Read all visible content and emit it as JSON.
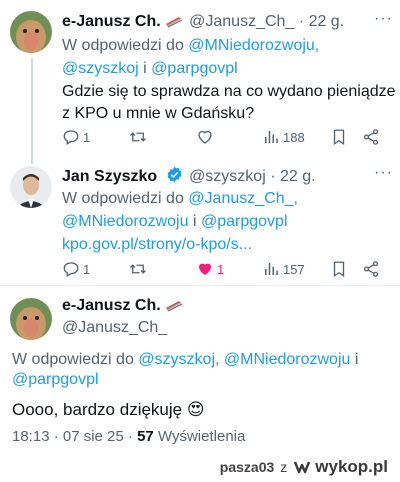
{
  "tweet1": {
    "name": "e-Janusz Ch.",
    "handle": "@Janusz_Ch_",
    "time": "22 g.",
    "reply_prefix": "W odpowiedzi do",
    "reply_to_1": "@MNiedorozwoju,",
    "reply_to_2": "@szyszkoj",
    "reply_and": "i",
    "reply_to_3": "@parpgovpl",
    "text_line1": "Gdzie się to sprawdza na co wydano pieniądze",
    "text_line2": "z KPO u mnie w Gdańsku?",
    "replies": "1",
    "views": "188"
  },
  "tweet2": {
    "name": "Jan Szyszko",
    "handle": "@szyszkoj",
    "time": "22 g.",
    "reply_prefix": "W odpowiedzi do",
    "reply_to_1": "@Janusz_Ch_,",
    "reply_to_2": "@MNiedorozwoju",
    "reply_and": "i",
    "reply_to_3": "@parpgovpl",
    "link": "kpo.gov.pl/strony/o-kpo/s...",
    "replies": "1",
    "likes": "1",
    "views": "157"
  },
  "tweet3": {
    "name": "e-Janusz Ch.",
    "handle": "@Janusz_Ch_",
    "reply_prefix": "W odpowiedzi do",
    "reply_to_1": "@szyszkoj,",
    "reply_to_2": "@MNiedorozwoju",
    "reply_and": "i",
    "reply_to_3": "@parpgovpl",
    "text": "Oooo, bardzo dziękuję",
    "emoji": "😍",
    "timestamp": "18:13 · 07 sie 25 ·",
    "views_count": "57",
    "views_label": "Wyświetlenia"
  },
  "watermark": {
    "user": "pasza03",
    "connector": "z",
    "site": "wykop.pl"
  },
  "colors": {
    "link": "#1d9bf0",
    "muted": "#536471",
    "like": "#f91880",
    "verified": "#1d9bf0"
  },
  "icons": [
    "more-icon",
    "reply-icon",
    "retweet-icon",
    "like-icon",
    "views-icon",
    "bookmark-icon",
    "share-icon",
    "verified-badge-icon",
    "sled-emoji-icon"
  ]
}
